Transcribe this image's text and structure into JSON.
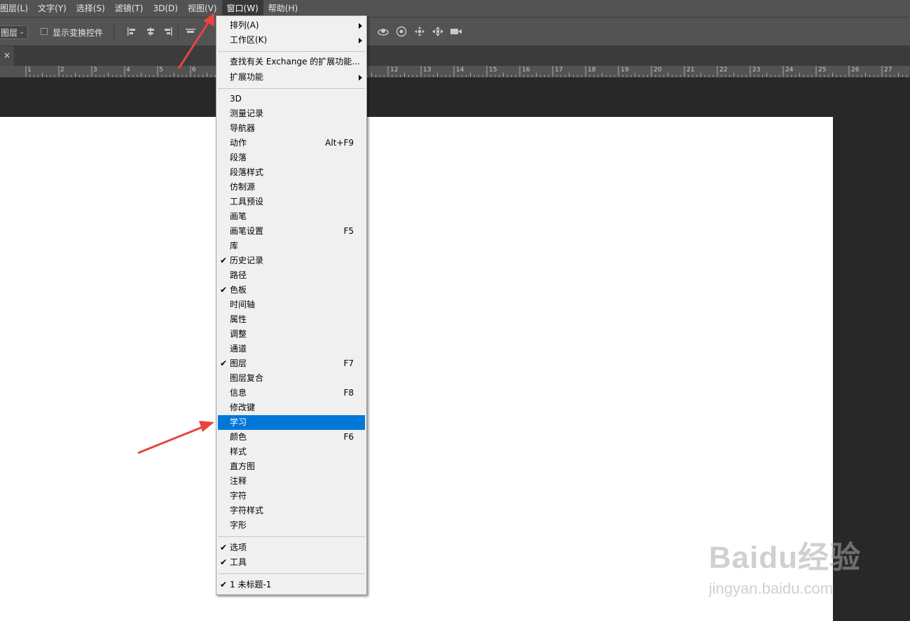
{
  "menubar": {
    "items": [
      "图层(L)",
      "文字(Y)",
      "选择(S)",
      "滤镜(T)",
      "3D(D)",
      "视图(V)",
      "窗口(W)",
      "帮助(H)"
    ],
    "active_index": 6
  },
  "options_bar": {
    "dropdown_value": "图层",
    "checkbox_label": "显示变换控件",
    "checkbox_checked": false
  },
  "tab": {
    "close_glyph": "×"
  },
  "ruler": {
    "labels": [
      "1",
      "2",
      "3",
      "4",
      "5",
      "6",
      "12",
      "13",
      "14",
      "15",
      "16",
      "17",
      "18",
      "19",
      "20",
      "21",
      "22",
      "23",
      "24",
      "25",
      "26",
      "27"
    ]
  },
  "window_menu": {
    "sections": [
      [
        {
          "label": "排列(A)",
          "submenu": true
        },
        {
          "label": "工作区(K)",
          "submenu": true
        }
      ],
      [
        {
          "label": "查找有关 Exchange 的扩展功能..."
        },
        {
          "label": "扩展功能",
          "submenu": true
        }
      ],
      [
        {
          "label": "3D"
        },
        {
          "label": "测量记录"
        },
        {
          "label": "导航器"
        },
        {
          "label": "动作",
          "shortcut": "Alt+F9"
        },
        {
          "label": "段落"
        },
        {
          "label": "段落样式"
        },
        {
          "label": "仿制源"
        },
        {
          "label": "工具预设"
        },
        {
          "label": "画笔"
        },
        {
          "label": "画笔设置",
          "shortcut": "F5"
        },
        {
          "label": "库"
        },
        {
          "label": "历史记录",
          "checked": true
        },
        {
          "label": "路径"
        },
        {
          "label": "色板",
          "checked": true
        },
        {
          "label": "时间轴"
        },
        {
          "label": "属性"
        },
        {
          "label": "调整"
        },
        {
          "label": "通道"
        },
        {
          "label": "图层",
          "shortcut": "F7",
          "checked": true
        },
        {
          "label": "图层复合"
        },
        {
          "label": "信息",
          "shortcut": "F8"
        },
        {
          "label": "修改键"
        },
        {
          "label": "学习",
          "highlighted": true
        },
        {
          "label": "颜色",
          "shortcut": "F6"
        },
        {
          "label": "样式"
        },
        {
          "label": "直方图"
        },
        {
          "label": "注释"
        },
        {
          "label": "字符"
        },
        {
          "label": "字符样式"
        },
        {
          "label": "字形"
        }
      ],
      [
        {
          "label": "选项",
          "checked": true
        },
        {
          "label": "工具",
          "checked": true
        }
      ],
      [
        {
          "label": "1 未标题-1",
          "checked": true
        }
      ]
    ],
    "check_glyph": "✔"
  },
  "colors": {
    "highlight": "#0078d7",
    "annotation_arrow": "#e8453c",
    "menu_background": "#f0f0f0"
  },
  "watermark": {
    "brand": "Baidu经验",
    "url": "jingyan.baidu.com"
  }
}
